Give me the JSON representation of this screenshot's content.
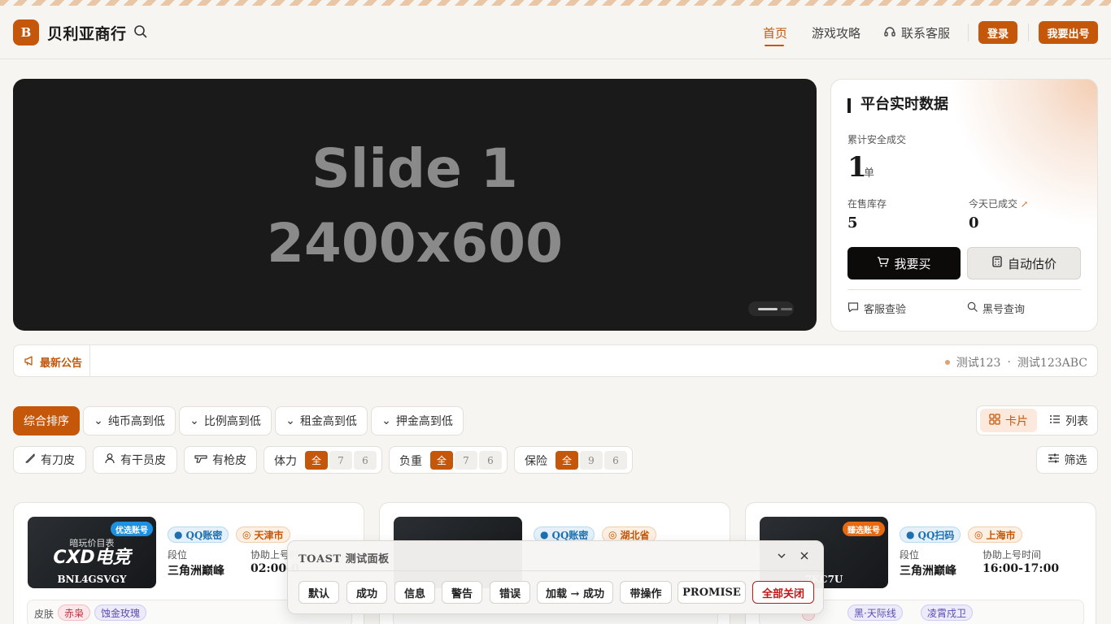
{
  "header": {
    "logo_letter": "B",
    "brand": "贝利亚商行",
    "nav": [
      "首页",
      "游戏攻略",
      "联系客服"
    ],
    "login": "登录",
    "sell": "我要出号"
  },
  "banner": {
    "line1": "Slide 1",
    "line2": "2400x600"
  },
  "stats": {
    "title": "平台实时数据",
    "total_label": "累计安全成交",
    "total_value": "1",
    "total_unit": "单",
    "stock_label": "在售库存",
    "stock_value": "5",
    "today_label": "今天已成交",
    "today_value": "0",
    "buy": "我要买",
    "estimate": "自动估价",
    "check": "客服查验",
    "blacklist": "黑号查询"
  },
  "announcement": {
    "label": "最新公告",
    "items": [
      "测试123",
      "测试123ABC"
    ],
    "separator": "·"
  },
  "sort": {
    "options": [
      "综合排序",
      "纯币高到低",
      "比例高到低",
      "租金高到低",
      "押金高到低"
    ],
    "view_card": "卡片",
    "view_list": "列表"
  },
  "filters": {
    "knife": "有刀皮",
    "operator": "有干员皮",
    "gun": "有枪皮",
    "stamina": {
      "label": "体力",
      "options": [
        "全",
        "7",
        "6"
      ]
    },
    "weight": {
      "label": "负重",
      "options": [
        "全",
        "7",
        "6"
      ]
    },
    "insurance": {
      "label": "保险",
      "options": [
        "全",
        "9",
        "6"
      ]
    },
    "filter_btn": "筛选"
  },
  "cards": [
    {
      "ribbon": "优选账号",
      "ribbon_color": "#1e90e0",
      "img_sub": "暗玩价目表",
      "img_logo": "CXD电竞",
      "code": "BNL4GSVGY",
      "login_type": "QQ账密",
      "region": "天津市",
      "rank_label": "段位",
      "rank": "三角洲巅峰",
      "time_label": "协助上号时",
      "time": "02:00-0",
      "skin_label": "皮肤",
      "skins": [
        "赤枭",
        "蚀金玫瑰"
      ]
    },
    {
      "login_type": "QQ账密",
      "region": "湖北省"
    },
    {
      "ribbon": "臻选账号",
      "ribbon_color": "#e86a10",
      "code": "7KC7U",
      "login_type": "QQ扫码",
      "region": "上海市",
      "rank_label": "段位",
      "rank": "三角洲巅峰",
      "time_label": "协助上号时间",
      "time": "16:00-17:00",
      "skins": [
        "黑·天际线",
        "凌霄戍卫"
      ]
    }
  ],
  "toast_panel": {
    "title": "TOAST 测试面板",
    "buttons": [
      "默认",
      "成功",
      "信息",
      "警告",
      "错误",
      "加载 → 成功",
      "带操作",
      "PROMISE",
      "全部关闭"
    ]
  }
}
